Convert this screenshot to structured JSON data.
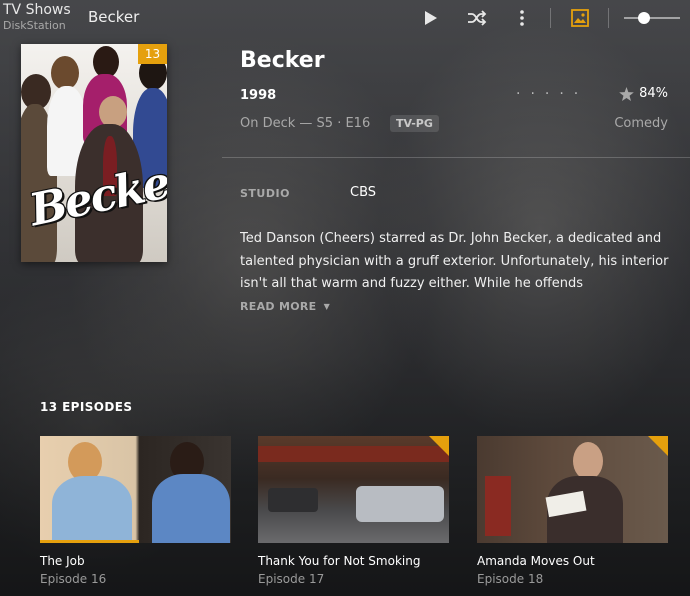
{
  "header": {
    "library_title": "TV Shows",
    "server_name": "DiskStation",
    "show_name": "Becker",
    "icons": [
      "play-icon",
      "shuffle-icon",
      "more-icon",
      "art-icon",
      "size-slider"
    ],
    "slider_value": 0.35
  },
  "poster": {
    "logo_text": "Becker",
    "unwatched_count": "13"
  },
  "details": {
    "title": "Becker",
    "year": "1998",
    "rating": "84%",
    "on_deck": "On Deck — S5 · E16",
    "content_rating": "TV-PG",
    "genre": "Comedy",
    "studio_label": "STUDIO",
    "studio_value": "CBS",
    "summary": "Ted Danson (Cheers) starred as Dr. John Becker, a dedicated and talented physician with a gruff exterior. Unfortunately, his interior isn't all that warm and fuzzy either. While he offends",
    "read_more": "READ MORE"
  },
  "episodes": {
    "heading": "13 EPISODES",
    "items": [
      {
        "name": "The Job",
        "number": "Episode 16",
        "progress": 0.52,
        "unwatched": false
      },
      {
        "name": "Thank You for Not Smoking",
        "number": "Episode 17",
        "progress": 0,
        "unwatched": true
      },
      {
        "name": "Amanda Moves Out",
        "number": "Episode 18",
        "progress": 0,
        "unwatched": true
      }
    ]
  },
  "colors": {
    "accent": "#e5a00d",
    "text_muted": "#a9a9a9"
  }
}
